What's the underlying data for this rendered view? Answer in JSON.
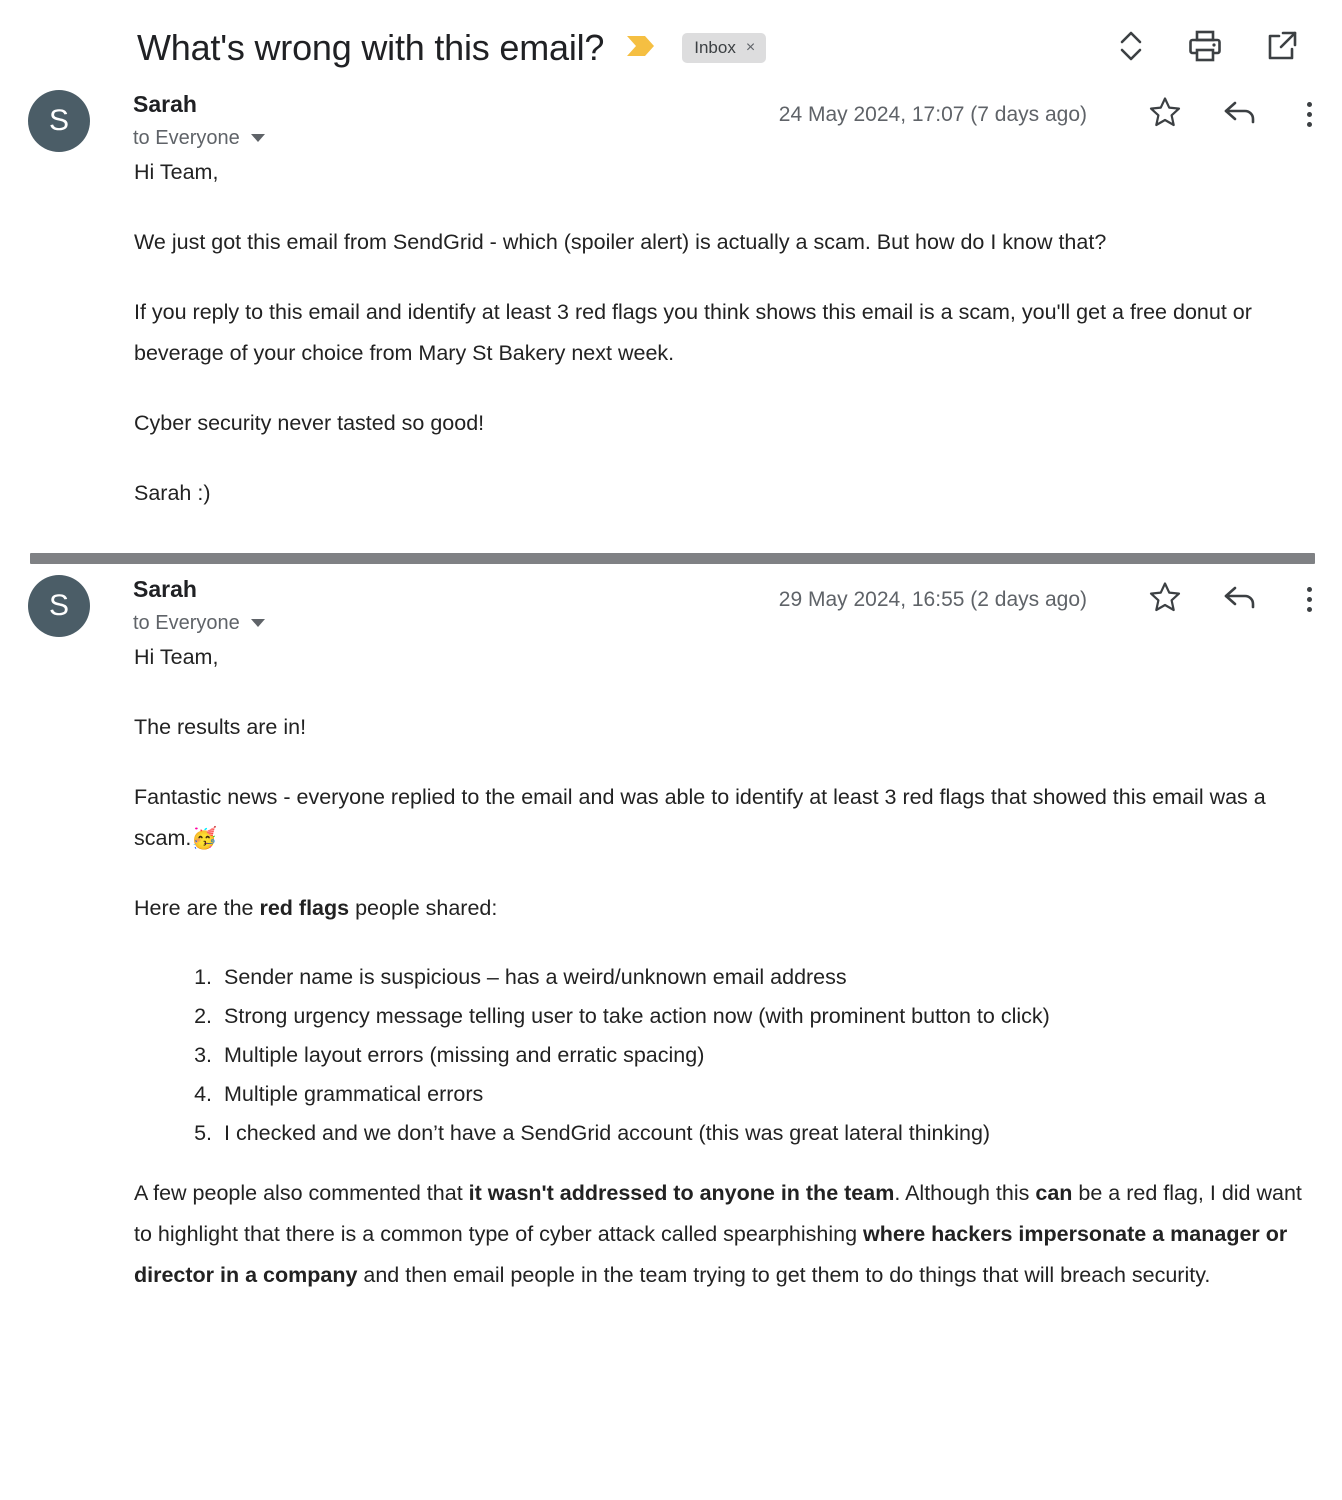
{
  "header": {
    "subject": "What's wrong with this email?",
    "flag_icon": "yellow-chevron-flag-icon",
    "label_chip": "Inbox",
    "label_chip_close": "×",
    "actions": [
      {
        "name": "collapse-all-icon",
        "title": "Collapse all"
      },
      {
        "name": "print-icon",
        "title": "Print all"
      },
      {
        "name": "open-in-new-window-icon",
        "title": "In new window"
      }
    ]
  },
  "messages": [
    {
      "avatar_initial": "S",
      "avatar_color": "#4b5d67",
      "sender": "Sarah",
      "recipient": "to Everyone",
      "date": "24 May 2024, 17:07 (7 days ago)",
      "actions": [
        {
          "name": "star-icon",
          "title": "Star"
        },
        {
          "name": "reply-icon",
          "title": "Reply"
        },
        {
          "name": "more-options-icon",
          "title": "More"
        }
      ],
      "body": {
        "greeting": "Hi Team,",
        "para1": "We just got this email from SendGrid - which (spoiler alert) is actually a scam. But how do I know that?",
        "para2": "If you reply to this email and identify at least 3 red flags you think shows this email is a scam, you'll get a free donut or beverage of your choice from Mary St Bakery next week.",
        "para3": "Cyber security never tasted so good!",
        "signoff": "Sarah :)"
      }
    },
    {
      "avatar_initial": "S",
      "avatar_color": "#4b5d67",
      "sender": "Sarah",
      "recipient": "to Everyone",
      "date": "29 May 2024, 16:55 (2 days ago)",
      "actions": [
        {
          "name": "star-icon",
          "title": "Star"
        },
        {
          "name": "reply-icon",
          "title": "Reply"
        },
        {
          "name": "more-options-icon",
          "title": "More"
        }
      ],
      "body": {
        "greeting": "Hi Team,",
        "para1": "The results are in!",
        "para2_pre": "Fantastic news - everyone replied to the email and was able to identify at least 3 red flags that showed this email was a scam.",
        "para2_emoji": "🥳",
        "intro_pre": "Here are the ",
        "intro_bold": "red flags",
        "intro_post": " people shared:",
        "red_flags": [
          "Sender name is suspicious – has a weird/unknown email address",
          "Strong urgency message telling user to take action now (with prominent button to click)",
          "Multiple layout errors (missing and erratic spacing)",
          "Multiple grammatical errors",
          "I checked and we don’t have a SendGrid account (this was great lateral thinking)"
        ],
        "closing_1": "A few people also commented that ",
        "closing_bold_1": "it wasn't addressed to anyone in the team",
        "closing_2": ". Although this ",
        "closing_bold_2": "can",
        "closing_3": " be a red flag, I did want to highlight that there is a common type of cyber attack called spearphishing ",
        "closing_bold_3": "where hackers impersonate a manager or director in a company",
        "closing_4": " and then email people in the team trying to get them to do things that will breach security."
      }
    }
  ]
}
